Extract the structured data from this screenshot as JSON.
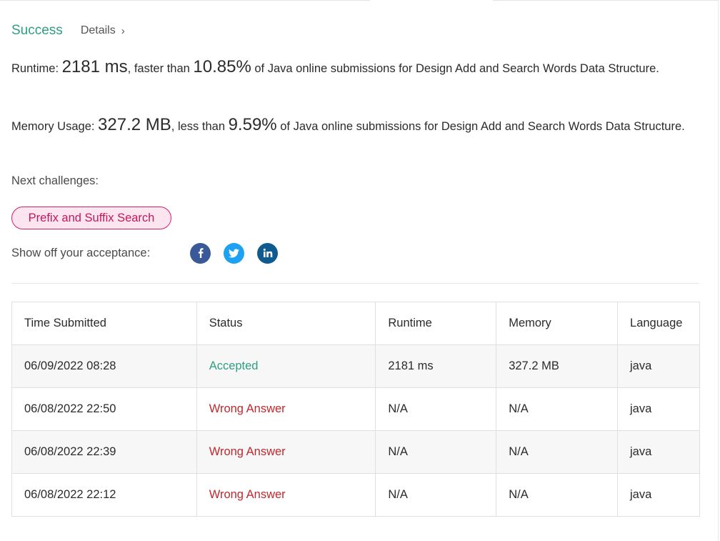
{
  "header": {
    "status": "Success",
    "details_label": "Details",
    "details_chevron": "›"
  },
  "runtime": {
    "label": "Runtime: ",
    "value": "2181 ms",
    "mid": ", faster than ",
    "percent": "10.85%",
    "suffix": " of Java online submissions for Design Add and Search Words Data Structure."
  },
  "memory": {
    "label": "Memory Usage: ",
    "value": "327.2 MB",
    "mid": ", less than ",
    "percent": "9.59%",
    "suffix": " of Java online submissions for Design Add and Search Words Data Structure."
  },
  "next": {
    "label": "Next challenges:",
    "challenge": "Prefix and Suffix Search"
  },
  "share": {
    "label": "Show off your acceptance:",
    "icons": [
      "facebook-icon",
      "twitter-icon",
      "linkedin-icon"
    ]
  },
  "table": {
    "headers": [
      "Time Submitted",
      "Status",
      "Runtime",
      "Memory",
      "Language"
    ],
    "rows": [
      {
        "time": "06/09/2022 08:28",
        "status": "Accepted",
        "runtime": "2181 ms",
        "memory": "327.2 MB",
        "language": "java"
      },
      {
        "time": "06/08/2022 22:50",
        "status": "Wrong Answer",
        "runtime": "N/A",
        "memory": "N/A",
        "language": "java"
      },
      {
        "time": "06/08/2022 22:39",
        "status": "Wrong Answer",
        "runtime": "N/A",
        "memory": "N/A",
        "language": "java"
      },
      {
        "time": "06/08/2022 22:12",
        "status": "Wrong Answer",
        "runtime": "N/A",
        "memory": "N/A",
        "language": "java"
      }
    ]
  },
  "colors": {
    "success": "#2e9e82",
    "wrong": "#c0282d",
    "pill": "#c2185b",
    "facebook": "#3b5998",
    "twitter": "#1da1f2",
    "linkedin": "#0f5b8f"
  }
}
